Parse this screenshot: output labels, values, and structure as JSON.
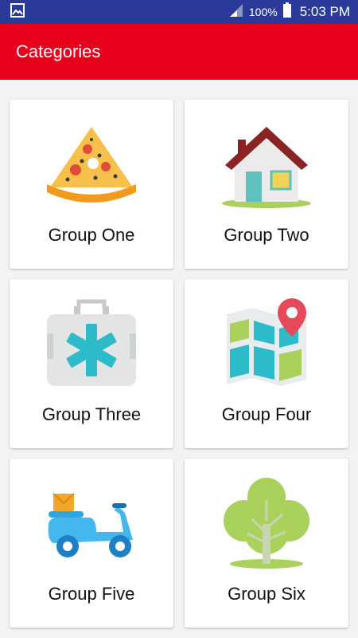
{
  "status_bar": {
    "battery_percent": "100%",
    "time": "5:03 PM",
    "icons": [
      "gallery-icon",
      "signal-icon",
      "battery-icon"
    ]
  },
  "app_bar": {
    "title": "Categories"
  },
  "categories": [
    {
      "label": "Group One",
      "icon": "pizza-icon"
    },
    {
      "label": "Group Two",
      "icon": "house-icon"
    },
    {
      "label": "Group Three",
      "icon": "first-aid-kit-icon"
    },
    {
      "label": "Group Four",
      "icon": "map-icon"
    },
    {
      "label": "Group Five",
      "icon": "scooter-icon"
    },
    {
      "label": "Group Six",
      "icon": "tree-icon"
    }
  ],
  "colors": {
    "status_bar": "#2b3a99",
    "app_bar": "#e8001c",
    "background": "#f2f3f5"
  }
}
